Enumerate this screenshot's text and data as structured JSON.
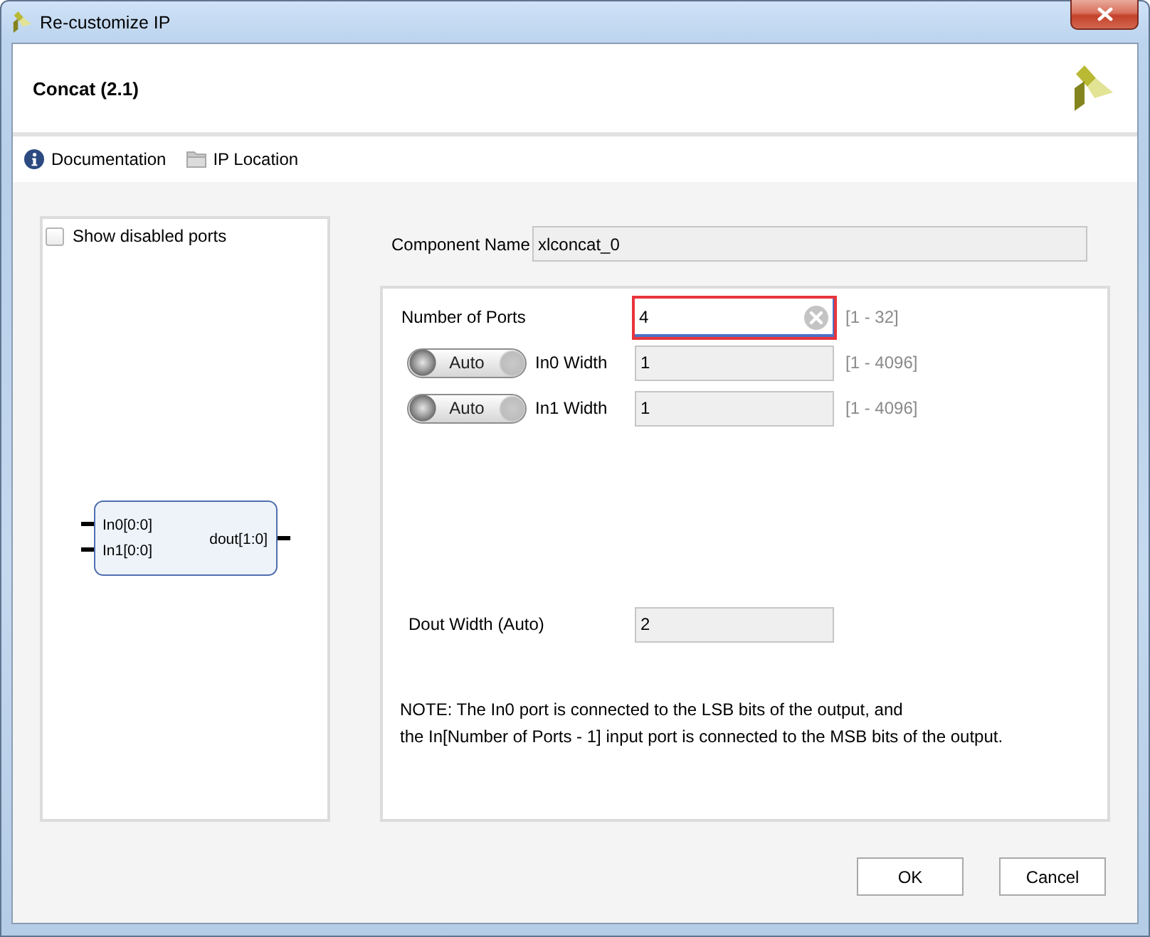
{
  "window": {
    "title": "Re-customize IP"
  },
  "header": {
    "title": "Concat (2.1)"
  },
  "toolbar": [
    {
      "kind": "info",
      "label": "Documentation"
    },
    {
      "kind": "folder",
      "label": "IP Location"
    }
  ],
  "symbol": {
    "show_disabled_ports": {
      "label": "Show disabled ports",
      "checked": false
    },
    "inputs": [
      "In0[0:0]",
      "In1[0:0]"
    ],
    "outputs": [
      "dout[1:0]"
    ]
  },
  "component_name": {
    "label": "Component Name",
    "value": "xlconcat_0"
  },
  "ports": {
    "label": "Number of Ports",
    "value": "4",
    "range": "[1 - 32]",
    "highlighted": true
  },
  "widths": [
    {
      "toggle": "Auto",
      "auto": true,
      "label": "In0 Width",
      "value": "1",
      "range": "[1 - 4096]"
    },
    {
      "toggle": "Auto",
      "auto": true,
      "label": "In1 Width",
      "value": "1",
      "range": "[1 - 4096]"
    }
  ],
  "dout": {
    "label": "Dout Width (Auto)",
    "value": "2"
  },
  "note": [
    "NOTE: The In0 port is connected to the LSB bits of the output, and",
    "the In[Number of Ports - 1] input port is connected to the MSB bits of the output."
  ],
  "buttons": [
    {
      "label": "OK"
    },
    {
      "label": "Cancel"
    }
  ]
}
